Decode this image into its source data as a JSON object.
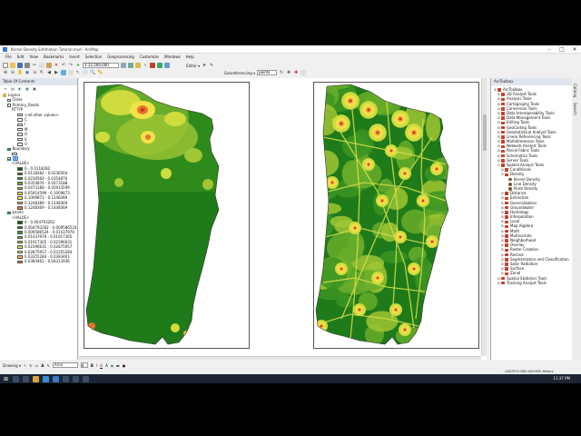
{
  "window": {
    "title": "Kernel Density Estimation Tutorial.mxd - ArcMap"
  },
  "menu": [
    "File",
    "Edit",
    "View",
    "Bookmarks",
    "Insert",
    "Selection",
    "Geoprocessing",
    "Customize",
    "Windows",
    "Help"
  ],
  "toolbar": {
    "scale_value": "1:12,500,000",
    "editor_label": "Editor ▾",
    "georef_label": "Georeferencing ▾",
    "georef_layer": "points"
  },
  "toc": {
    "title": "Table Of Contents",
    "layers_label": "Layers",
    "items": [
      {
        "label": "Cities",
        "level": 1,
        "checked": false
      },
      {
        "label": "Primary_Roads",
        "level": 1,
        "checked": false
      },
      {
        "label": "RTTYP",
        "level": 2
      },
      {
        "label": "<all other values>",
        "level": 3,
        "swatch": "#ffffff"
      },
      {
        "label": "C",
        "level": 3,
        "swatch": "#ffffff"
      },
      {
        "label": "I",
        "level": 3,
        "swatch": "#ffffff"
      },
      {
        "label": "M",
        "level": 3,
        "swatch": "#ffffff"
      },
      {
        "label": "O",
        "level": 3,
        "swatch": "#ffffff"
      },
      {
        "label": "S",
        "level": 3,
        "swatch": "#ffffff"
      },
      {
        "label": "U",
        "level": 3,
        "swatch": "#ffffff"
      },
      {
        "label": "Boundary",
        "level": 1,
        "checked": true
      },
      {
        "label": "",
        "level": 2,
        "swatch": "#ffffff"
      },
      {
        "label": "kd",
        "level": 1,
        "checked": true,
        "highlight": true
      },
      {
        "label": "<VALUE>",
        "level": 2
      },
      {
        "label": "0 - 0.0118282",
        "level": 3,
        "swatch": "#0d5e13"
      },
      {
        "label": "0.0118282 - 0.0236564",
        "level": 3,
        "swatch": "#1f7a1a"
      },
      {
        "label": "0.0236564 - 0.0354876",
        "level": 3,
        "swatch": "#3c9522"
      },
      {
        "label": "0.0354876 - 0.0473188",
        "level": 3,
        "swatch": "#69ad2a"
      },
      {
        "label": "0.0473188 - 0.05914599",
        "level": 3,
        "swatch": "#9fc634"
      },
      {
        "label": "0.05914599 - 0.1009873",
        "level": 3,
        "swatch": "#cfdc3e"
      },
      {
        "label": "0.1009873 - 0.1248389",
        "level": 3,
        "swatch": "#f2e24a"
      },
      {
        "label": "0.1248389 - 0.1248369",
        "level": 3,
        "swatch": "#f6b33e"
      },
      {
        "label": "0.1248369 - 0.1448369",
        "level": 3,
        "swatch": "#e8742e"
      },
      {
        "label": "points",
        "level": 1,
        "checked": true
      },
      {
        "label": "<VALUE>",
        "level": 2
      },
      {
        "label": "0 - 0.004793262",
        "level": 3,
        "swatch": "#0d5e13"
      },
      {
        "label": "0.004793262 - 0.009586524",
        "level": 3,
        "swatch": "#1f7a1a"
      },
      {
        "label": "0.009586524 - 0.01437979",
        "level": 3,
        "swatch": "#3c9522"
      },
      {
        "label": "0.01437979 - 0.01917305",
        "level": 3,
        "swatch": "#69ad2a"
      },
      {
        "label": "0.01917305 - 0.02396631",
        "level": 3,
        "swatch": "#9fc634"
      },
      {
        "label": "0.02396631 - 0.02875957",
        "level": 3,
        "swatch": "#cfdc3e"
      },
      {
        "label": "0.02875957 - 0.03355284",
        "level": 3,
        "swatch": "#f2e24a"
      },
      {
        "label": "0.03355284 - 0.0383461",
        "level": 3,
        "swatch": "#f6b33e"
      },
      {
        "label": "0.0383461 - 0.04313936",
        "level": 3,
        "swatch": "#e8742e"
      }
    ]
  },
  "toolbox": {
    "title": "ArcToolbox",
    "items": [
      {
        "label": "ArcToolbox",
        "level": 0,
        "type": "root"
      },
      {
        "label": "3D Analyst Tools",
        "level": 1,
        "type": "toolbox"
      },
      {
        "label": "Analysis Tools",
        "level": 1,
        "type": "toolbox"
      },
      {
        "label": "Cartography Tools",
        "level": 1,
        "type": "toolbox"
      },
      {
        "label": "Conversion Tools",
        "level": 1,
        "type": "toolbox"
      },
      {
        "label": "Data Interoperability Tools",
        "level": 1,
        "type": "toolbox"
      },
      {
        "label": "Data Management Tools",
        "level": 1,
        "type": "toolbox"
      },
      {
        "label": "Editing Tools",
        "level": 1,
        "type": "toolbox"
      },
      {
        "label": "GeoCoding Tools",
        "level": 1,
        "type": "toolbox"
      },
      {
        "label": "Geostatistical Analyst Tools",
        "level": 1,
        "type": "toolbox"
      },
      {
        "label": "Linear Referencing Tools",
        "level": 1,
        "type": "toolbox"
      },
      {
        "label": "Multidimension Tools",
        "level": 1,
        "type": "toolbox"
      },
      {
        "label": "Network Analyst Tools",
        "level": 1,
        "type": "toolbox"
      },
      {
        "label": "Parcel Fabric Tools",
        "level": 1,
        "type": "toolbox"
      },
      {
        "label": "Schematics Tools",
        "level": 1,
        "type": "toolbox"
      },
      {
        "label": "Server Tools",
        "level": 1,
        "type": "toolbox"
      },
      {
        "label": "Spatial Analyst Tools",
        "level": 1,
        "type": "toolbox",
        "expanded": true
      },
      {
        "label": "Conditional",
        "level": 2,
        "type": "toolbox"
      },
      {
        "label": "Density",
        "level": 2,
        "type": "toolbox",
        "expanded": true
      },
      {
        "label": "Kernel Density",
        "level": 3,
        "type": "tool"
      },
      {
        "label": "Line Density",
        "level": 3,
        "type": "tool"
      },
      {
        "label": "Point Density",
        "level": 3,
        "type": "tool"
      },
      {
        "label": "Distance",
        "level": 2,
        "type": "toolbox"
      },
      {
        "label": "Extraction",
        "level": 2,
        "type": "toolbox"
      },
      {
        "label": "Generalization",
        "level": 2,
        "type": "toolbox"
      },
      {
        "label": "Groundwater",
        "level": 2,
        "type": "toolbox"
      },
      {
        "label": "Hydrology",
        "level": 2,
        "type": "toolbox"
      },
      {
        "label": "Interpolation",
        "level": 2,
        "type": "toolbox"
      },
      {
        "label": "Local",
        "level": 2,
        "type": "toolbox"
      },
      {
        "label": "Map Algebra",
        "level": 2,
        "type": "toolbox"
      },
      {
        "label": "Math",
        "level": 2,
        "type": "toolbox"
      },
      {
        "label": "Multivariate",
        "level": 2,
        "type": "toolbox"
      },
      {
        "label": "Neighborhood",
        "level": 2,
        "type": "toolbox"
      },
      {
        "label": "Overlay",
        "level": 2,
        "type": "toolbox"
      },
      {
        "label": "Raster Creation",
        "level": 2,
        "type": "toolbox"
      },
      {
        "label": "Reclass",
        "level": 2,
        "type": "toolbox"
      },
      {
        "label": "Segmentation and Classification",
        "level": 2,
        "type": "toolbox"
      },
      {
        "label": "Solar Radiation",
        "level": 2,
        "type": "toolbox"
      },
      {
        "label": "Surface",
        "level": 2,
        "type": "toolbox"
      },
      {
        "label": "Zonal",
        "level": 2,
        "type": "toolbox"
      },
      {
        "label": "Spatial Statistics Tools",
        "level": 1,
        "type": "toolbox"
      },
      {
        "label": "Tracking Analyst Tools",
        "level": 1,
        "type": "toolbox"
      }
    ]
  },
  "side_tabs": [
    "Catalog",
    "Search"
  ],
  "drawing": {
    "label": "Drawing ▾",
    "font": "Arial",
    "size": "8"
  },
  "status": {
    "coords": "-1647915.268  1620905 Meters"
  },
  "taskbar": {
    "clock": "11:37 PM"
  },
  "colors": {
    "ramp": [
      "#0d5e13",
      "#1f7a1a",
      "#3c9522",
      "#69ad2a",
      "#9fc634",
      "#cfdc3e",
      "#f2e24a",
      "#f6b33e",
      "#e8742e",
      "#c73a26"
    ],
    "selection": "#3878d8"
  }
}
